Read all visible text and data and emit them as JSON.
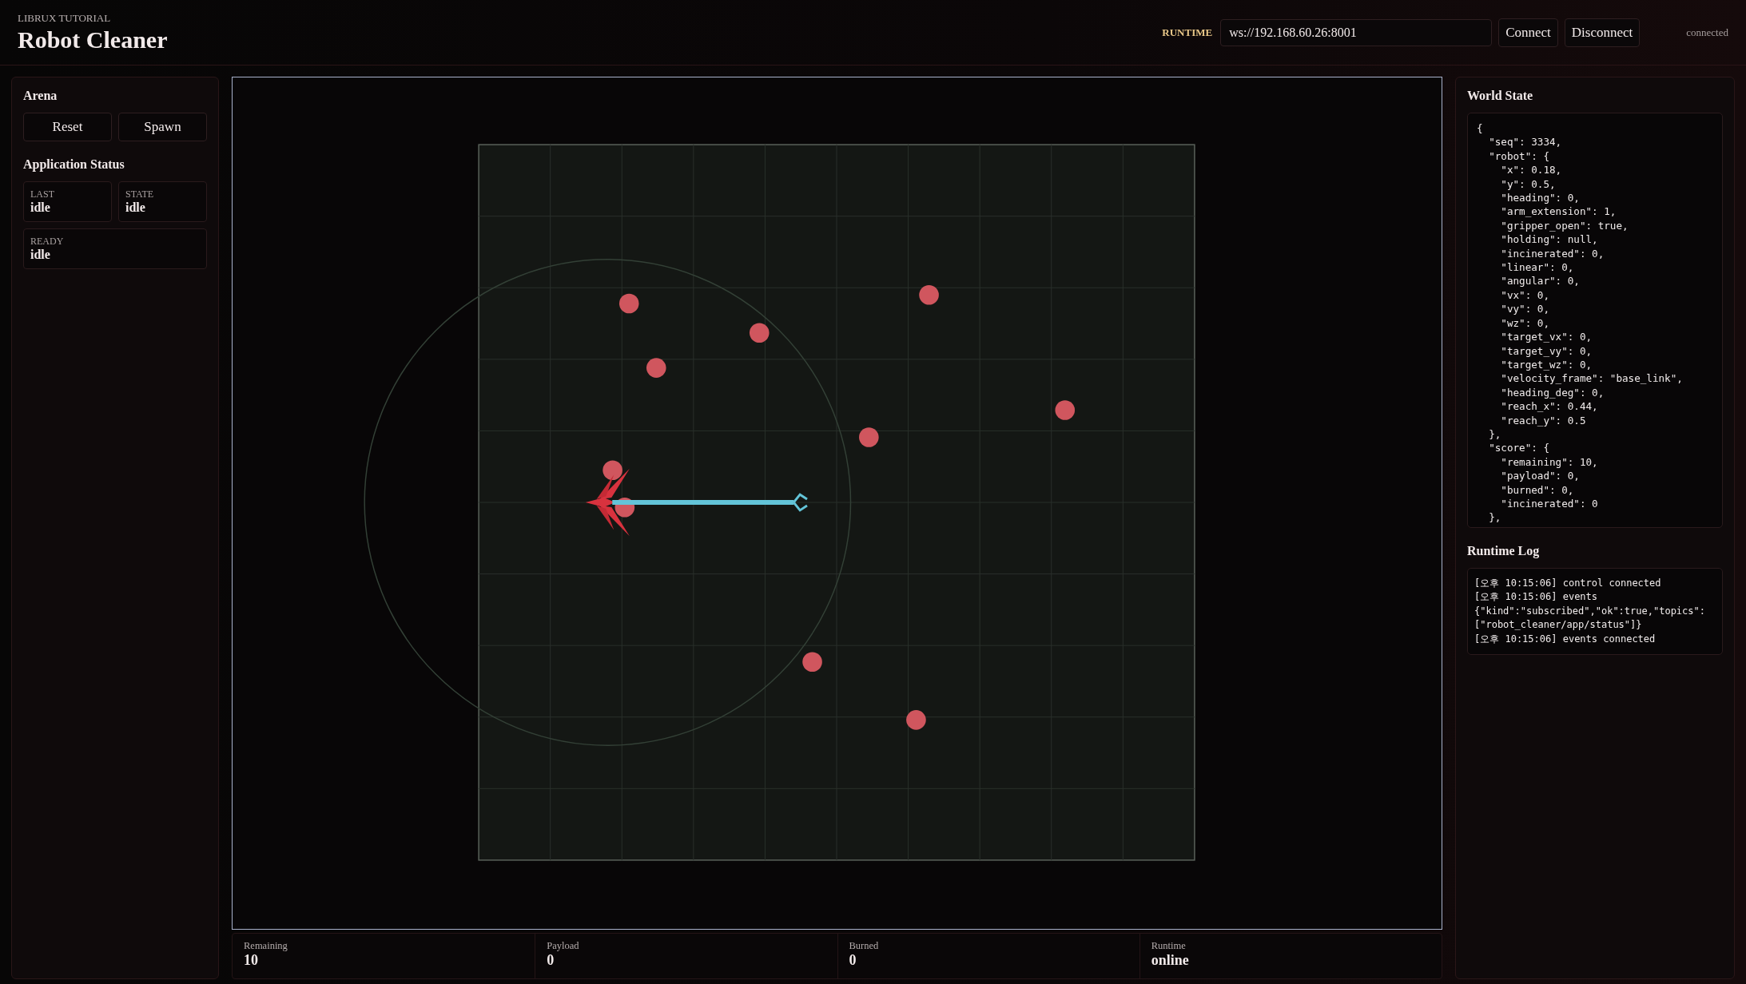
{
  "header": {
    "kicker": "LIBRUX TUTORIAL",
    "title": "Robot Cleaner",
    "runtime_label": "RUNTIME",
    "url": "ws://192.168.60.26:8001",
    "buttons": [
      "Connect",
      "Disconnect"
    ],
    "status": "connected"
  },
  "arena": {
    "title": "Arena",
    "buttons": [
      "Reset",
      "Spawn"
    ]
  },
  "application_status": {
    "title": "Application Status",
    "fields": [
      {
        "label": "LAST",
        "value": "idle"
      },
      {
        "label": "STATE",
        "value": "idle"
      },
      {
        "label": "READY",
        "value": "idle"
      }
    ]
  },
  "stats": [
    {
      "label": "Remaining",
      "value": "10"
    },
    {
      "label": "Payload",
      "value": "0"
    },
    {
      "label": "Burned",
      "value": "0"
    },
    {
      "label": "Runtime",
      "value": "online"
    }
  ],
  "world_state": {
    "title": "World State",
    "text": "{\n  \"seq\": 3334,\n  \"robot\": {\n    \"x\": 0.18,\n    \"y\": 0.5,\n    \"heading\": 0,\n    \"arm_extension\": 1,\n    \"gripper_open\": true,\n    \"holding\": null,\n    \"incinerated\": 0,\n    \"linear\": 0,\n    \"angular\": 0,\n    \"vx\": 0,\n    \"vy\": 0,\n    \"wz\": 0,\n    \"target_vx\": 0,\n    \"target_vy\": 0,\n    \"target_wz\": 0,\n    \"velocity_frame\": \"base_link\",\n    \"heading_deg\": 0,\n    \"reach_x\": 0.44,\n    \"reach_y\": 0.5\n  },\n  \"score\": {\n    \"remaining\": 10,\n    \"payload\": 0,\n    \"burned\": 0,\n    \"incinerated\": 0\n  },"
  },
  "runtime_log": {
    "title": "Runtime Log",
    "entries": [
      "[오후 10:15:06] control connected",
      "[오후 10:15:06] events\n{\"kind\":\"subscribed\",\"ok\":true,\"topics\":\n[\"robot_cleaner/app/status\"]}",
      "[오후 10:15:06] events connected"
    ]
  }
}
